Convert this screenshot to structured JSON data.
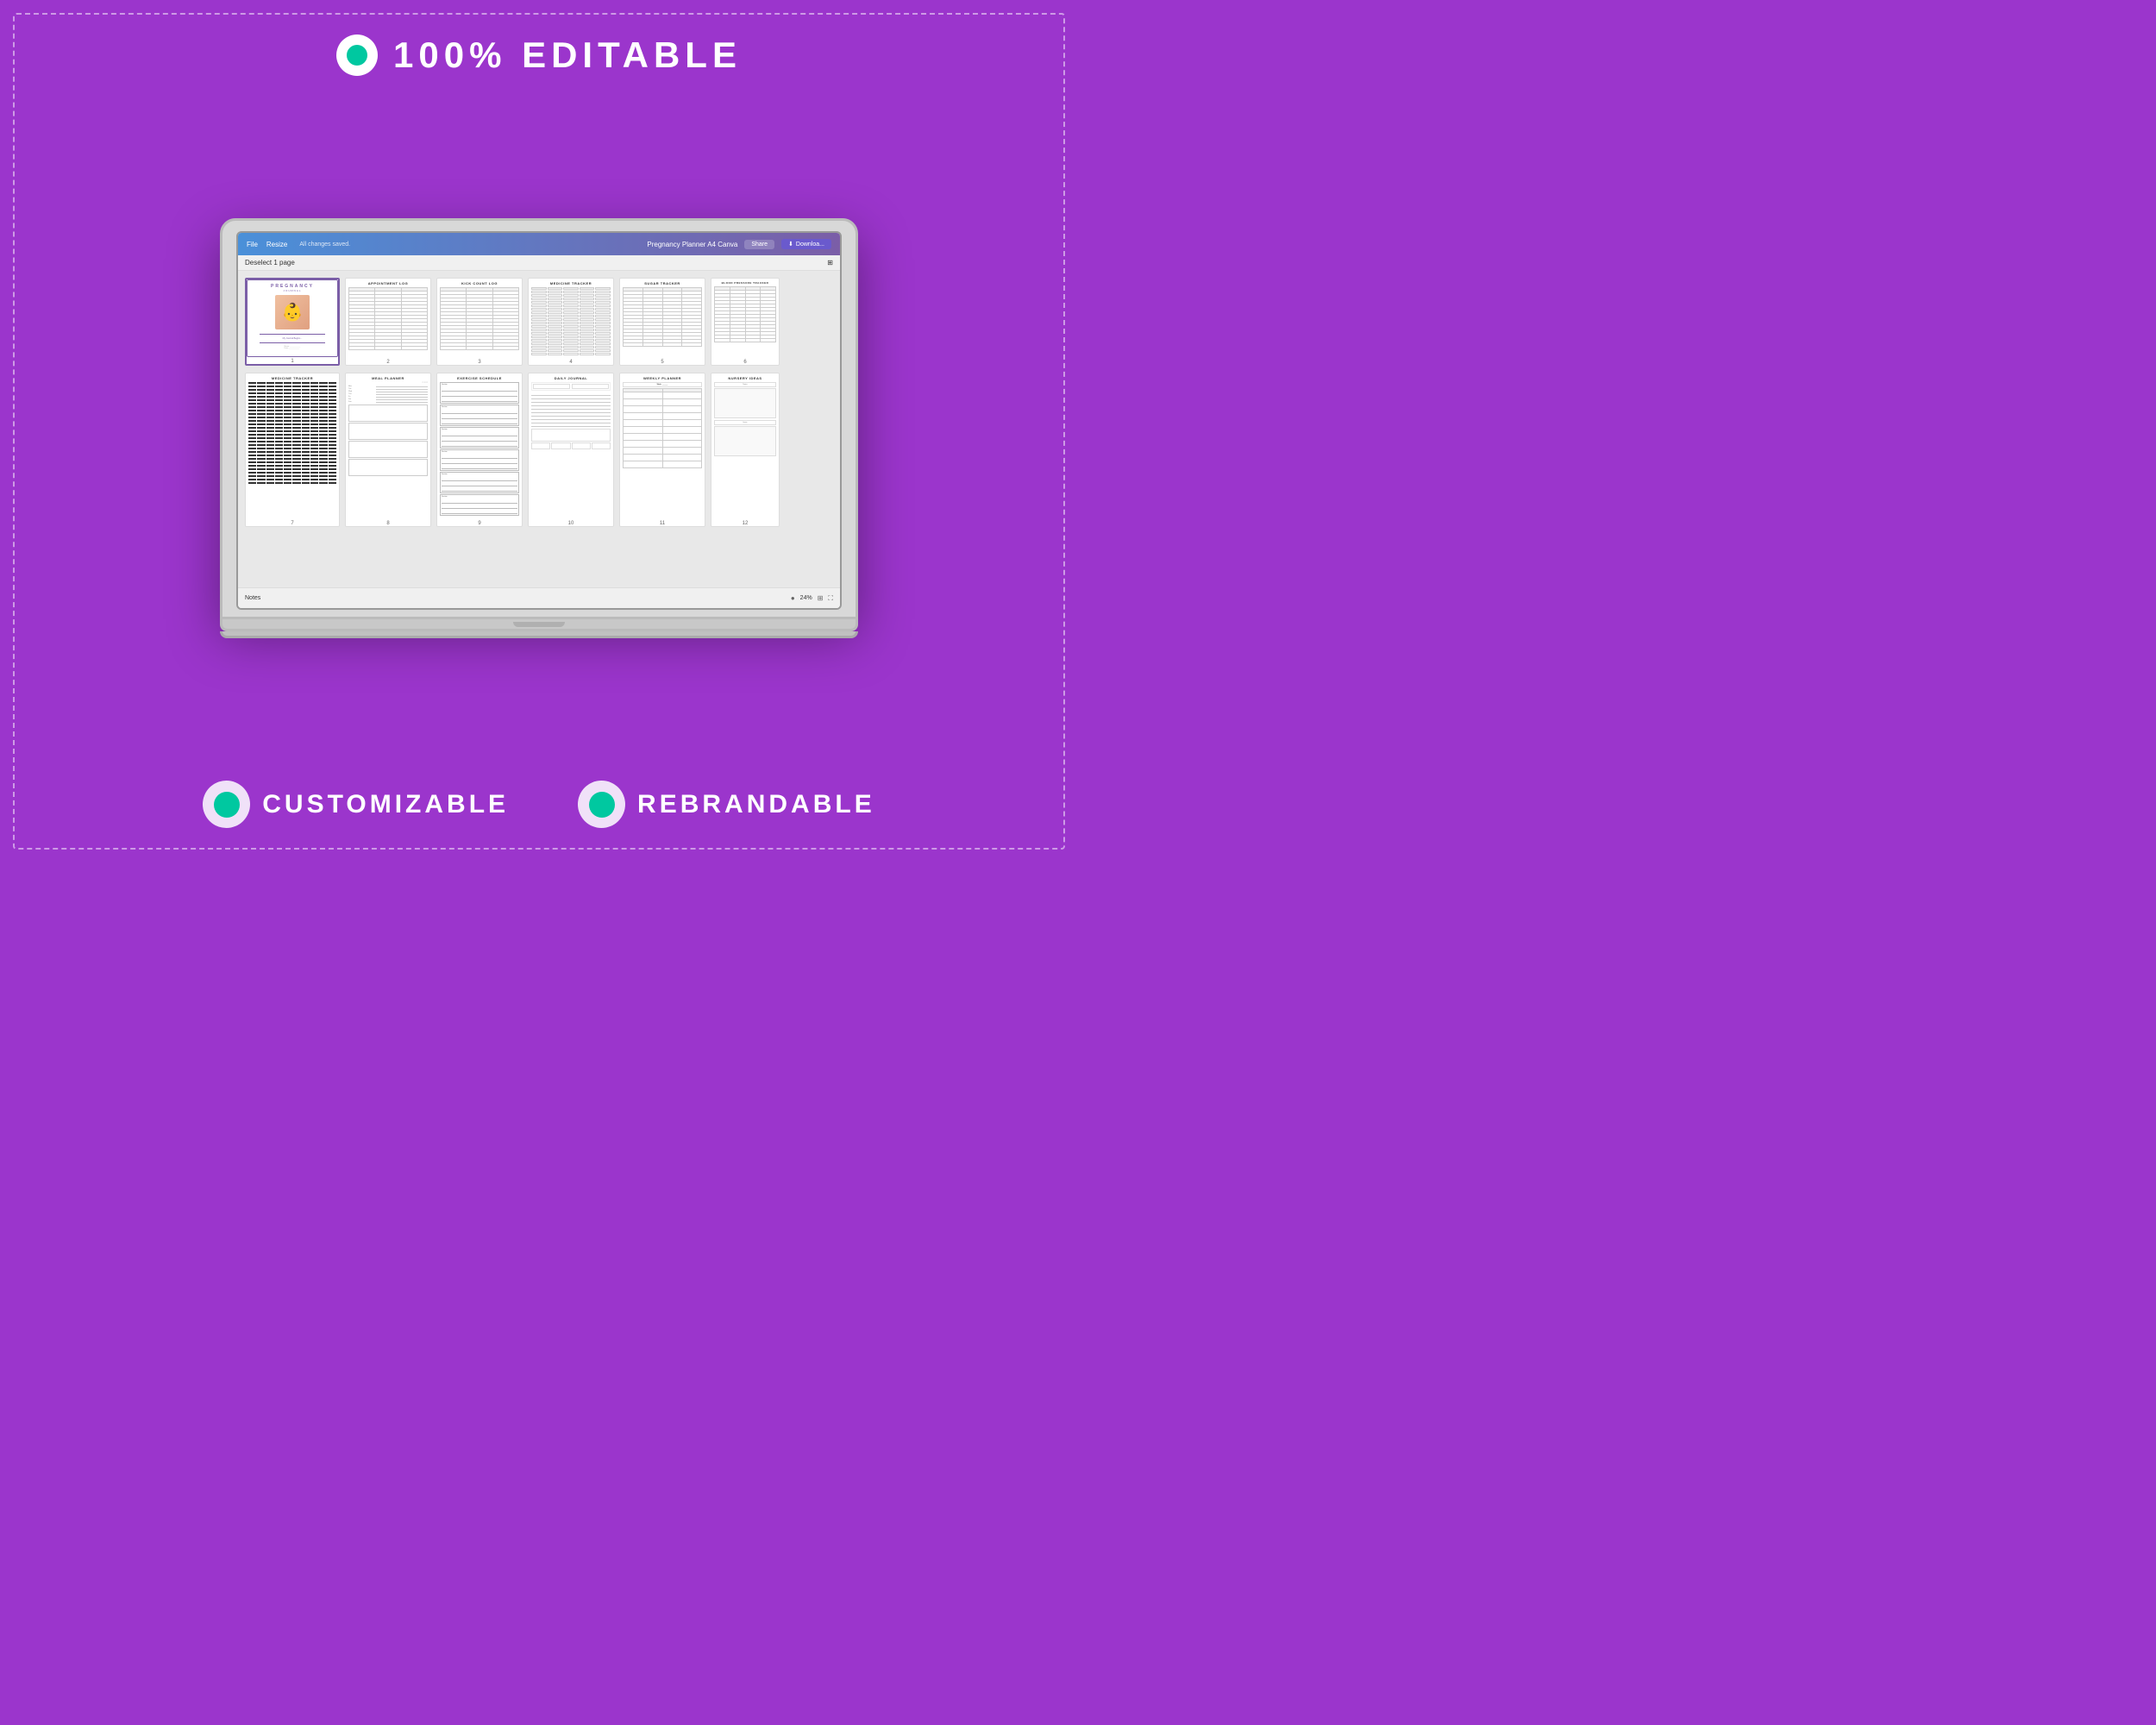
{
  "header": {
    "icon": "circle-check-icon",
    "title": "100% EDITABLE"
  },
  "laptop": {
    "toolbar": {
      "file": "File",
      "resize": "Resize",
      "saved": "All changes saved.",
      "doc_title": "Pregnancy Planner A4 Canva",
      "share": "Share",
      "download": "Downloa..."
    },
    "deselect": "Deselect 1 page",
    "pages": [
      {
        "num": "1",
        "title": "PREGNANCY JOURNAL",
        "type": "cover"
      },
      {
        "num": "2",
        "title": "APPOINTMENT LOG",
        "type": "table"
      },
      {
        "num": "3",
        "title": "KICK COUNT LOG",
        "type": "table"
      },
      {
        "num": "4",
        "title": "MEDICINE TRACKER",
        "type": "table"
      },
      {
        "num": "5",
        "title": "SUGAR TRACKER",
        "type": "table"
      },
      {
        "num": "6",
        "title": "BLOOD PRESSURE TRACKER",
        "type": "table"
      },
      {
        "num": "7",
        "title": "MEDICINE TRACKER",
        "type": "grid"
      },
      {
        "num": "8",
        "title": "MEAL PLANNER",
        "type": "lines"
      },
      {
        "num": "9",
        "title": "EXERCISE SCHEDULE",
        "type": "exercise"
      },
      {
        "num": "10",
        "title": "DAILY JOURNAL",
        "type": "journal"
      },
      {
        "num": "11",
        "title": "WEEKLY PLANNER",
        "type": "planner"
      },
      {
        "num": "12",
        "title": "NURSERY IDEAS",
        "type": "nursery"
      }
    ],
    "notes": "Notes",
    "zoom": "24%"
  },
  "bottom": {
    "feature1": "CUSTOMIZABLE",
    "feature2": "REBRANDABLE"
  }
}
